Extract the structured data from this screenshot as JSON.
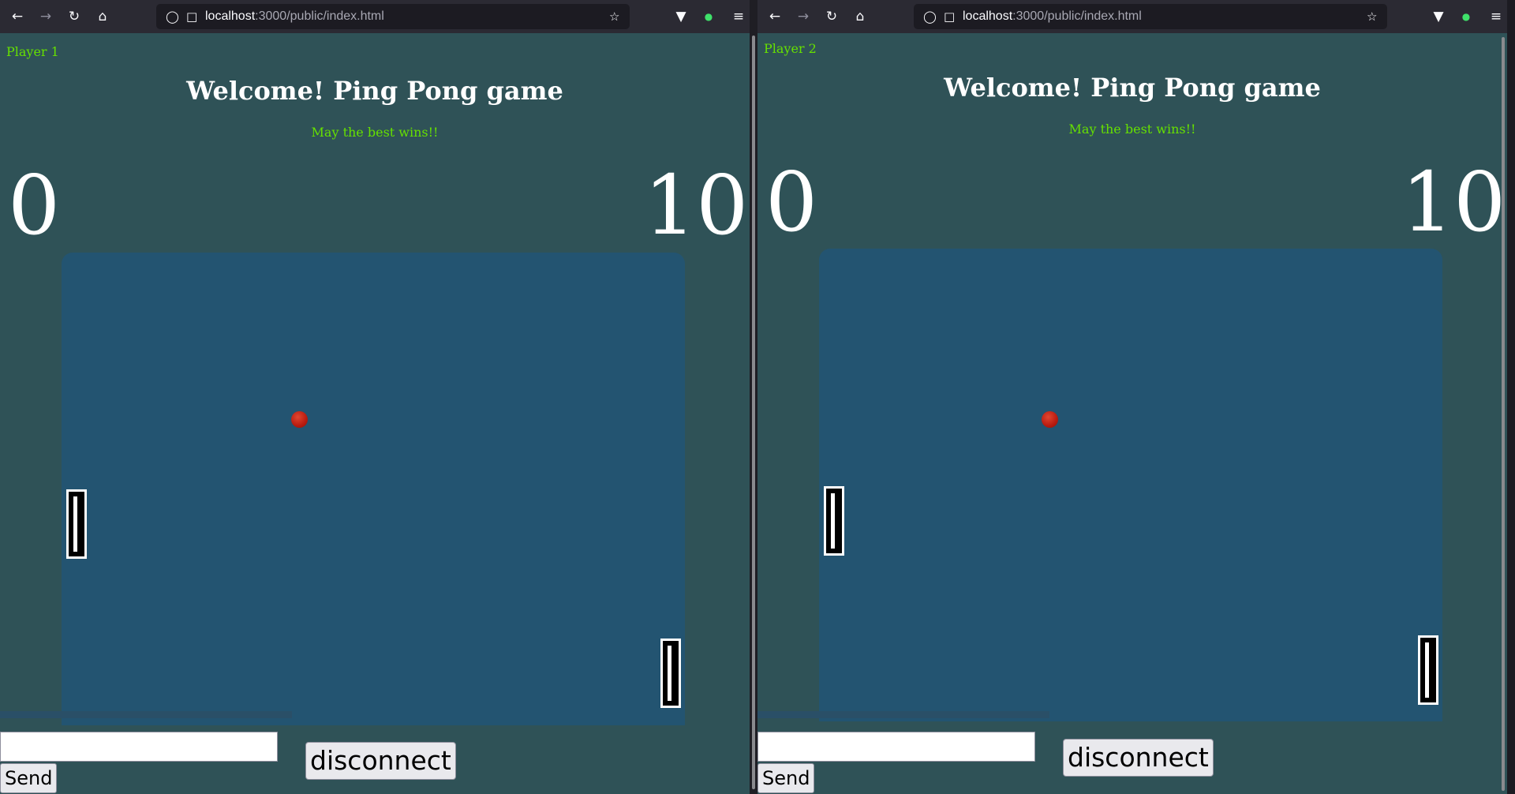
{
  "colors": {
    "page_bg": "#2f5257",
    "court": "#235471",
    "accent_green": "#66e000",
    "ball": "#b81b10",
    "toolbar": "#2b2a33"
  },
  "browser": {
    "url_host": "localhost",
    "url_path": ":3000/public/index.html",
    "icons": [
      "back-arrow-icon",
      "forward-arrow-icon",
      "reload-icon",
      "home-icon",
      "shield-icon",
      "page-icon",
      "bookmark-star-icon",
      "pocket-icon",
      "extension-icon",
      "hamburger-menu-icon"
    ]
  },
  "windows": [
    {
      "player_label": "Player 1",
      "title": "Welcome! Ping Pong game",
      "motto": "May the best wins!!",
      "score_left": "0",
      "score_right": "10",
      "input_value": "",
      "send_label": "Send",
      "disconnect_label": "disconnect"
    },
    {
      "player_label": "Player 2",
      "title": "Welcome! Ping Pong game",
      "motto": "May the best wins!!",
      "score_left": "0",
      "score_right": "10",
      "input_value": "",
      "send_label": "Send",
      "disconnect_label": "disconnect"
    }
  ]
}
